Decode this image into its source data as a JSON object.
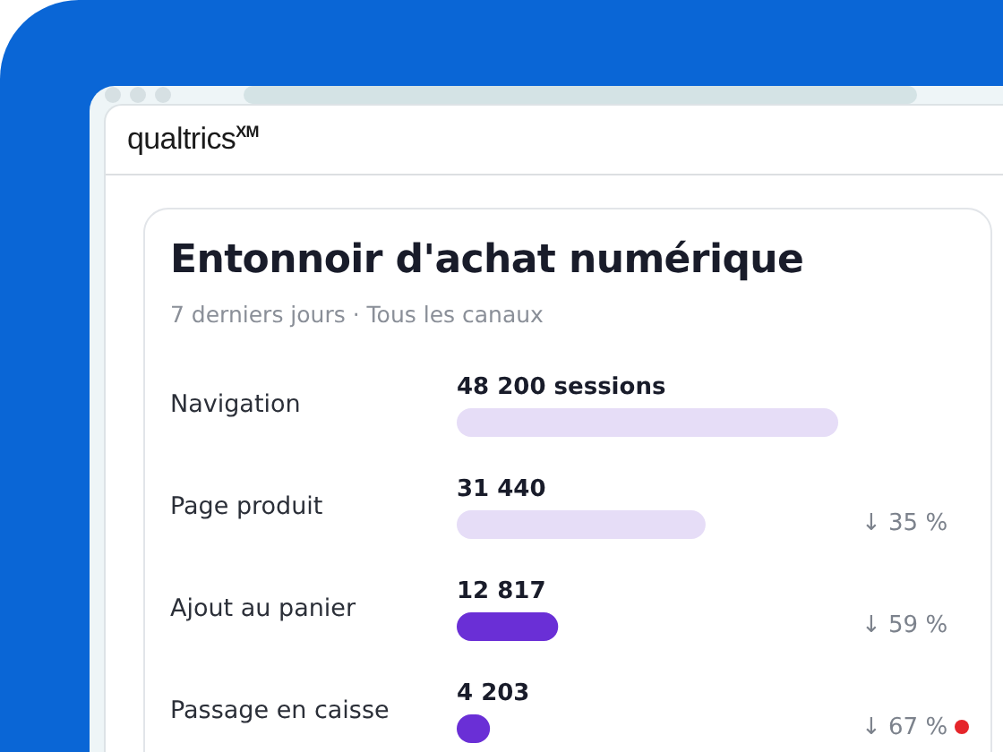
{
  "app": {
    "logo": "qualtrics$^{XM}$"
  },
  "card": {
    "title": "Entonnoir d'achat numérique",
    "subtitle": "7 derniers jours · Tous les canaux",
    "steps": [
      {
        "highlighted": false
      },
      {
        "highlighted": false,
        "drop": "↓ 35 %",
        "alert": false
      },
      {
        "highlighted": true,
        "drop": "↓ 59 %",
        "alert": false
      },
      {
        "highlighted": true,
        "drop": "↓ 67 %",
        "alert": true
      }
    ],
    "chart_data": {
      "type": "bar",
      "orientation": "horizontal",
      "categories": [
        "Navigation",
        "Page produit",
        "Ajout au panier",
        "Passage en caisse"
      ],
      "values": [
        48200,
        31440,
        12817,
        4203
      ],
      "value_labels": [
        "48 200 sessions",
        "31 440",
        "12 817",
        "4 203"
      ]
    }
  }
}
